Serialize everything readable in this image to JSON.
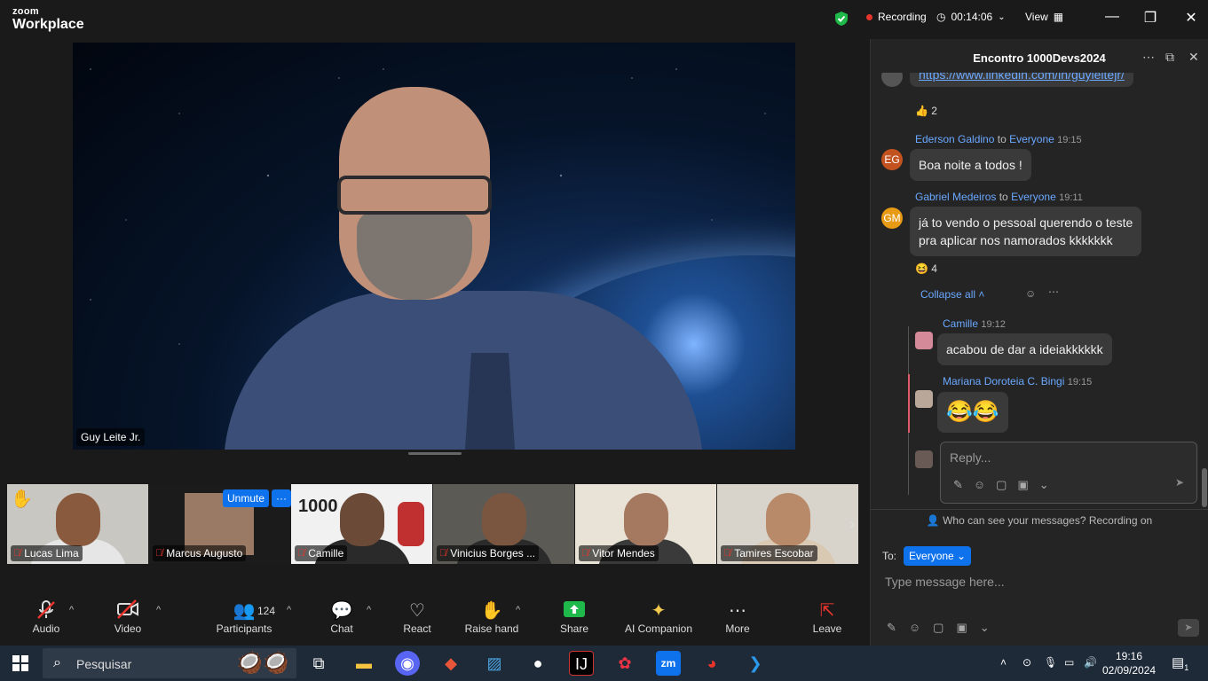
{
  "titlebar": {
    "logo_top": "zoom",
    "logo_bottom": "Workplace",
    "recording_label": "Recording",
    "timer": "00:14:06",
    "view_label": "View"
  },
  "speaker": {
    "name": "Guy Leite Jr."
  },
  "gallery": {
    "unmute_label": "Unmute",
    "more_label": "···",
    "tiles": [
      {
        "name": "Lucas Lima"
      },
      {
        "name": "Marcus Augusto"
      },
      {
        "name": "Camille"
      },
      {
        "name": "Vinicius Borges ..."
      },
      {
        "name": "Vitor Mendes"
      },
      {
        "name": "Tamires Escobar"
      }
    ]
  },
  "toolbar": {
    "audio": "Audio",
    "video": "Video",
    "participants": "Participants",
    "participants_count": "124",
    "chat": "Chat",
    "react": "React",
    "raise_hand": "Raise hand",
    "share": "Share",
    "ai_companion": "AI Companion",
    "more": "More",
    "leave": "Leave"
  },
  "chat": {
    "title": "Encontro 1000Devs2024",
    "link": "https://www.linkedin.com/in/guyleitejr/",
    "link_reaction": "2",
    "messages": [
      {
        "initials": "EG",
        "sender": "Ederson Galdino",
        "to": "to",
        "recipient": "Everyone",
        "time": "19:15",
        "text": "Boa noite a todos !"
      },
      {
        "initials": "GM",
        "sender": "Gabriel Medeiros",
        "to": "to",
        "recipient": "Everyone",
        "time": "19:11",
        "text_line1": "já to vendo o pessoal querendo o teste",
        "text_line2": "pra aplicar nos namorados kkkkkkk",
        "reaction": "4"
      }
    ],
    "collapse_label": "Collapse all",
    "replies": [
      {
        "sender": "Camille",
        "time": "19:12",
        "text": "acabou de dar a ideiakkkkkk"
      },
      {
        "sender": "Mariana Doroteia C. Bingi",
        "time": "19:15",
        "text": "😂😂"
      }
    ],
    "reply_placeholder": "Reply...",
    "who_can_see": "Who can see your messages? Recording on",
    "to_label": "To:",
    "to_value": "Everyone",
    "type_placeholder": "Type message here..."
  },
  "taskbar": {
    "search_placeholder": "Pesquisar",
    "zoom_icon_label": "zm",
    "time": "19:16",
    "date": "02/09/2024",
    "notif_count": "1"
  }
}
